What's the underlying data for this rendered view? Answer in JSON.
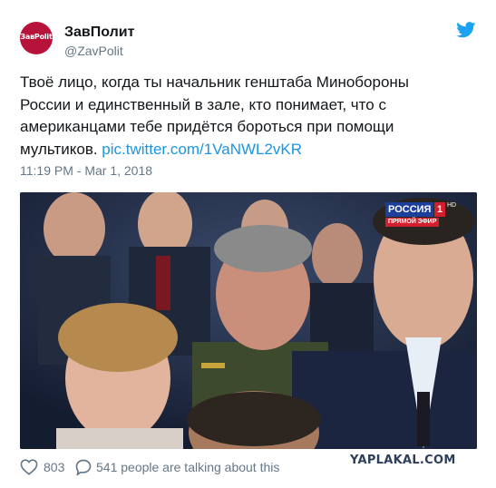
{
  "author": {
    "avatar_text": "ЗавPolit",
    "display_name": "ЗавПолит",
    "handle": "@ZavPolit"
  },
  "tweet": {
    "text": "Твоё лицо, когда ты начальник генштаба Минобороны России и единственный в зале, кто понимает, что с американцами тебе придётся бороться при помощи мультиков. ",
    "link": "pic.twitter.com/1VaNWL2vKR",
    "timestamp": "11:19 PM - Mar 1, 2018"
  },
  "media": {
    "channel_name": "РОССИЯ",
    "channel_number": "1",
    "channel_hd": "HD",
    "live_label": "ПРЯМОЙ ЭФИР"
  },
  "footer": {
    "like_count": "803",
    "reply_text": "541 people are talking about this"
  },
  "watermark": "YAPLAKAL.COM",
  "colors": {
    "link": "#1b95e0",
    "secondary_text": "#657786",
    "twitter_blue": "#1da1f2",
    "avatar_bg": "#b7133a"
  },
  "icons": [
    "twitter-bird-icon",
    "heart-icon",
    "reply-bubble-icon"
  ]
}
